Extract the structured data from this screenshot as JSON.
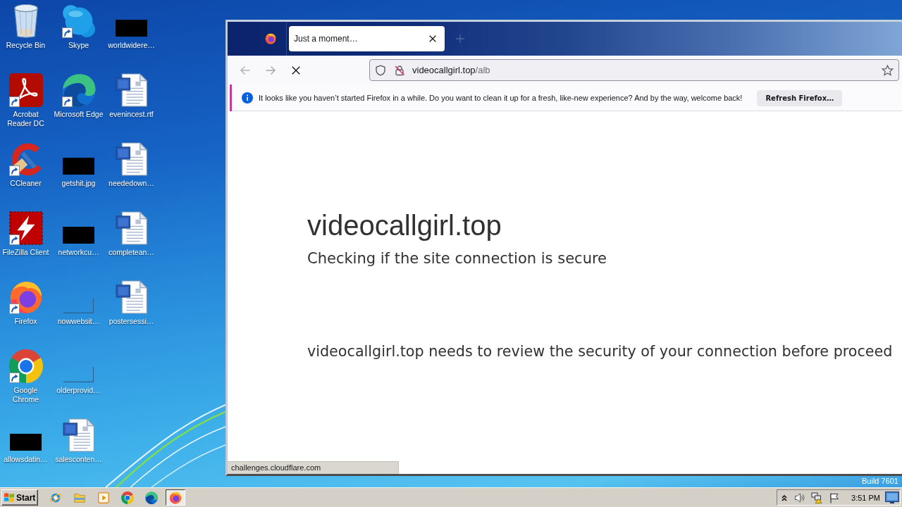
{
  "desktop": {
    "icons": [
      {
        "label": "Recycle Bin",
        "kind": "recycle-bin",
        "shortcut": false
      },
      {
        "label": "Acrobat Reader DC",
        "kind": "acrobat",
        "shortcut": true
      },
      {
        "label": "CCleaner",
        "kind": "ccleaner",
        "shortcut": true
      },
      {
        "label": "FileZilla Client",
        "kind": "filezilla",
        "shortcut": true
      },
      {
        "label": "Firefox",
        "kind": "firefox",
        "shortcut": true
      },
      {
        "label": "Google Chrome",
        "kind": "chrome",
        "shortcut": true
      },
      {
        "label": "allowsdatin…",
        "kind": "dark-thumbnail",
        "shortcut": false
      },
      {
        "label": "Skype",
        "kind": "skype",
        "shortcut": true
      },
      {
        "label": "Microsoft Edge",
        "kind": "edge",
        "shortcut": true
      },
      {
        "label": "getshit.jpg",
        "kind": "dark-thumbnail",
        "shortcut": false
      },
      {
        "label": "networkcu…",
        "kind": "dark-thumbnail",
        "shortcut": false
      },
      {
        "label": "nowwebsit…",
        "kind": "blank-thumbnail",
        "shortcut": false
      },
      {
        "label": "olderprovid…",
        "kind": "blank-thumbnail",
        "shortcut": false
      },
      {
        "label": "salesconten…",
        "kind": "word-document",
        "shortcut": false
      },
      {
        "label": "worldwidere…",
        "kind": "dark-thumbnail",
        "shortcut": false
      },
      {
        "label": "evenincest.rtf",
        "kind": "word-document",
        "shortcut": false
      },
      {
        "label": "neededown…",
        "kind": "word-document",
        "shortcut": false
      },
      {
        "label": "completean…",
        "kind": "word-document",
        "shortcut": false
      },
      {
        "label": "postersessi…",
        "kind": "word-document",
        "shortcut": false
      }
    ],
    "build_label": "Build 7601"
  },
  "browser": {
    "tabs": [
      {
        "title": "Just a moment…",
        "selected": true
      }
    ],
    "nav_buttons": [
      {
        "kind": "back",
        "disabled": true
      },
      {
        "kind": "forward",
        "disabled": true
      },
      {
        "kind": "stop",
        "disabled": false
      }
    ],
    "address_bar": {
      "host": "videocallgirl.top",
      "path": "/alb"
    },
    "notification": {
      "message": "It looks like you haven’t started Firefox in a while. Do you want to clean it up for a fresh, like-new experience? And by the way, welcome back!",
      "button": "Refresh Firefox…"
    },
    "page": {
      "heading": "videocallgirl.top",
      "subheading": "Checking if the site connection is secure",
      "body": "videocallgirl.top needs to review the security of your connection before proceed"
    },
    "status_text": "challenges.cloudflare.com"
  },
  "taskbar": {
    "start_label": "Start",
    "apps": [
      {
        "kind": "internet-explorer",
        "selected": false
      },
      {
        "kind": "file-explorer",
        "selected": false
      },
      {
        "kind": "media-player",
        "selected": false
      },
      {
        "kind": "chrome",
        "selected": false
      },
      {
        "kind": "edge",
        "selected": false
      },
      {
        "kind": "firefox",
        "selected": true
      }
    ],
    "tray": {
      "time": "3:51 PM"
    }
  }
}
